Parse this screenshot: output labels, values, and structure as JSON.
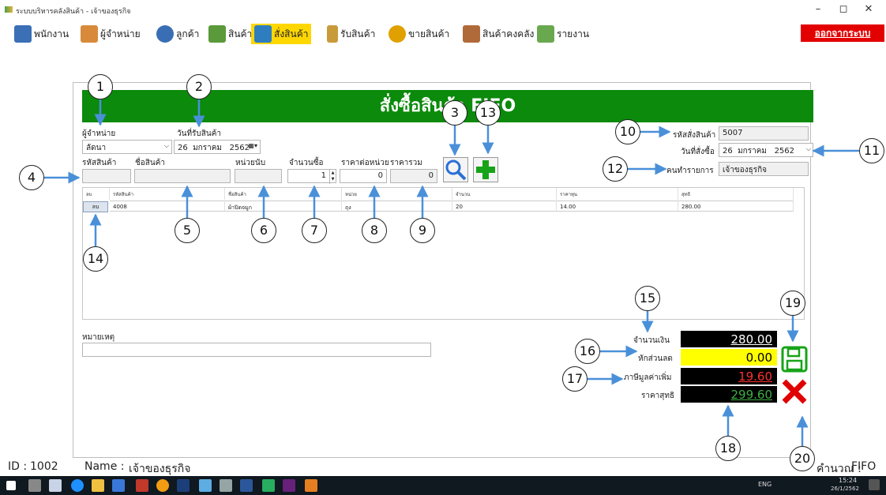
{
  "window": {
    "title": "ระบบบริหารคลังสินค้า - เจ้าของธุรกิจ",
    "controls": [
      "–",
      "◻",
      "✕"
    ]
  },
  "menu": {
    "items": [
      {
        "label": "พนักงาน",
        "color": "#3b6fb6"
      },
      {
        "label": "ผู้จำหน่าย",
        "color": "#d88a3a"
      },
      {
        "label": "ลูกค้า",
        "color": "#3a6eb4"
      },
      {
        "label": "สินค้า",
        "color": "#5a9a3a"
      },
      {
        "label": "สั่งสินค้า",
        "color": "#2e7dbf",
        "active": true
      },
      {
        "label": "รับสินค้า",
        "color": "#c89a3a"
      },
      {
        "label": "ขายสินค้า",
        "color": "#e0a000"
      },
      {
        "label": "สินค้าคงคลัง",
        "color": "#b06a3a"
      },
      {
        "label": "รายงาน",
        "color": "#6aa84f"
      }
    ],
    "logout": "ออกจากระบบ"
  },
  "form": {
    "title": "สั่งซื้อสินค้า FIFO",
    "supplier_label": "ผู้จำหน่าย",
    "supplier_value": "ลัดนา",
    "receive_date_label": "วันที่รับสินค้า",
    "receive_date": {
      "day": "26",
      "month": "มกราคม",
      "year": "2562"
    },
    "product_code_label": "รหัสสินค้า",
    "product_name_label": "ชื่อสินค้า",
    "unit_label": "หน่วยนับ",
    "qty_label": "จำนวนซื้อ",
    "qty_value": "1",
    "unit_price_label": "ราคาต่อหน่วย",
    "unit_price_value": "0",
    "total_price_label": "ราคารวม",
    "total_price_value": "0",
    "order_id_label": "รหัสสั่งสินค้า",
    "order_id_value": "5007",
    "order_date_label": "วันที่สั่งซื้อ",
    "order_date": {
      "day": "26",
      "month": "มกราคม",
      "year": "2562"
    },
    "operator_label": "คนทำรายการ",
    "operator_value": "เจ้าของธุรกิจ",
    "note_label": "หมายเหตุ"
  },
  "table": {
    "columns": [
      "ลบ",
      "รหัสสินค้า",
      "ชื่อสินค้า",
      "หน่วย",
      "จำนวน",
      "ราคาทุน",
      "สุทธิ"
    ],
    "rows": [
      {
        "del": "ลบ",
        "code": "4008",
        "name": "ผ้าปิดจมูก",
        "unit": "ถุง",
        "qty": "20",
        "cost": "14.00",
        "net": "280.00"
      }
    ]
  },
  "totals": {
    "amount_label": "จำนวนเงิน",
    "amount": "280.00",
    "discount_label": "หักส่วนลด",
    "discount": "0.00",
    "vat_label": "ภาษีมูลค่าเพิ่ม",
    "vat": "19.60",
    "net_label": "ราคาสุทธิ",
    "net": "299.60"
  },
  "colors": {
    "header": "#0b8a0b",
    "discount_bg": "#ffff00",
    "vat_text": "#ff3030",
    "net_text": "#3cb043",
    "save": "#17a317",
    "cancel": "#e00000"
  },
  "status": {
    "id_label": "ID :",
    "id_value": "1002",
    "name_label": "Name :",
    "name_value": "เจ้าของธุรกิจ",
    "calc_label": "คำนวณ :",
    "calc_value": "FIFO"
  },
  "callouts": [
    "1",
    "2",
    "3",
    "4",
    "5",
    "6",
    "7",
    "8",
    "9",
    "10",
    "11",
    "12",
    "13",
    "14",
    "15",
    "16",
    "17",
    "18",
    "19",
    "20"
  ],
  "taskbar": {
    "time": "15:24",
    "date": "26/1/2562",
    "lang": "ENG"
  }
}
